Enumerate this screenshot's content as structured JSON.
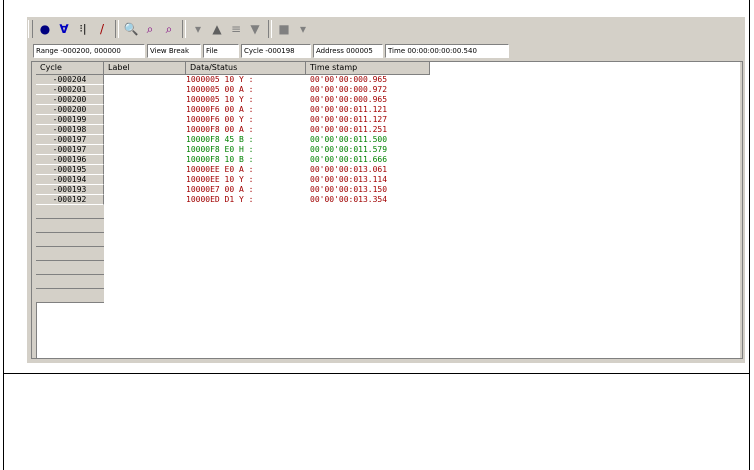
{
  "toolbar": {
    "icons": [
      "grip-icon",
      "dot-icon",
      "filter-icon",
      "bars-icon",
      "marker-icon",
      "search-icon",
      "search-prev-icon",
      "search-next-icon",
      "dropdown-arrow-icon",
      "scroll-up-icon",
      "scroll-equal-icon",
      "scroll-down-icon",
      "square-icon",
      "square-dropdown-icon"
    ]
  },
  "status": {
    "range": "Range -000200, 000000",
    "view_break": "View Break",
    "file": "File",
    "cycle": "Cycle -000198",
    "address": "Address 000005",
    "time": "Time 00:00:00:00:00.540"
  },
  "columns": {
    "cycle": "Cycle",
    "label": "Label",
    "data": "Data/Status",
    "time": "Time stamp"
  },
  "rows": [
    {
      "cycle": "-000204",
      "data": "1000005  10 Y :",
      "time": "00'00'00:000.965",
      "color": "#a00000"
    },
    {
      "cycle": "-000201",
      "data": "1000005  00 A :",
      "time": "00'00'00:000.972",
      "color": "#a00000"
    },
    {
      "cycle": "-000200",
      "data": "1000005  10 Y :",
      "time": "00'00'00:000.965",
      "color": "#a00000"
    },
    {
      "cycle": "-000200",
      "data": "10000F6  00 A :",
      "time": "00'00'00:011.121",
      "color": "#a00000"
    },
    {
      "cycle": "-000199",
      "data": "10000F6  00 Y :",
      "time": "00'00'00:011.127",
      "color": "#a00000"
    },
    {
      "cycle": "-000198",
      "data": "10000F8  00 A :",
      "time": "00'00'00:011.251",
      "color": "#a00000"
    },
    {
      "cycle": "-000197",
      "data": "10000F8  45 B :",
      "time": "00'00'00:011.500",
      "color": "#008000"
    },
    {
      "cycle": "-000197",
      "data": "10000F8  E0 H :",
      "time": "00'00'00:011.579",
      "color": "#008000"
    },
    {
      "cycle": "-000196",
      "data": "10000F8  10 B :",
      "time": "00'00'00:011.666",
      "color": "#008000"
    },
    {
      "cycle": "-000195",
      "data": "10000EE  E0 A :",
      "time": "00'00'00:013.061",
      "color": "#a00000"
    },
    {
      "cycle": "-000194",
      "data": "10000EE  10 Y :",
      "time": "00'00'00:013.114",
      "color": "#a00000"
    },
    {
      "cycle": "-000193",
      "data": "10000E7  00 A :",
      "time": "00'00'00:013.150",
      "color": "#a00000"
    },
    {
      "cycle": "-000192",
      "data": "10000ED  D1 Y :",
      "time": "00'00'00:013.354",
      "color": "#a00000"
    }
  ]
}
